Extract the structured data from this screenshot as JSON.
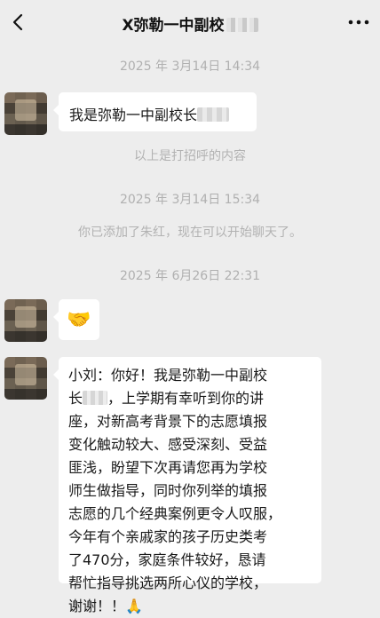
{
  "header": {
    "title": "X弥勒一中副校",
    "back_icon": "chevron-left-icon",
    "more_icon": "more-dots-icon"
  },
  "messages": {
    "ts1": "2025 年 3月14日 14:34",
    "msg1_text": "我是弥勒一中副校长",
    "sys1": "以上是打招呼的内容",
    "ts2": "2025 年 3月14日 15:34",
    "sys2": "你已添加了朱红，现在可以开始聊天了。",
    "ts3": "2025 年 6月26日 22:31",
    "msg2_emoji": "🤝",
    "msg3_lines": [
      "小刘：你好！我是弥勒一中副校",
      "长",
      "，上学期有幸听到你的讲",
      "座，对新高考背景下的志愿填报",
      "变化触动较大、感受深刻、受益",
      "匪浅，盼望下次再请您再为学校",
      "师生做指导，同时你列举的填报",
      "志愿的几个经典案例更令人叹服，",
      "今年有个亲戚家的孩子历史类考",
      "了470分，家庭条件较好，恳请",
      "帮忙指导挑选两所心仪的学校，",
      "谢谢！！🙏"
    ]
  }
}
